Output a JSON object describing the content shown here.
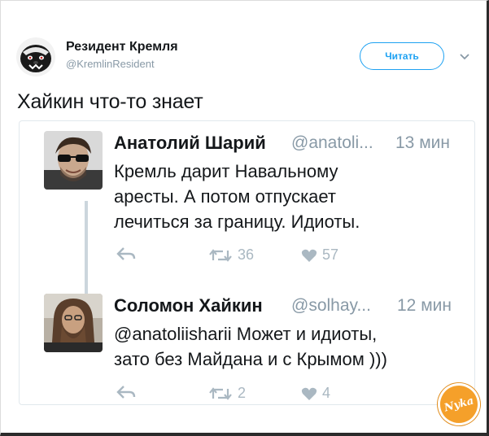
{
  "tweet": {
    "author_name": "Резидент Кремля",
    "author_handle": "@KremlinResident",
    "follow_label": "Читать",
    "text": "Хайкин что-то знает"
  },
  "quoted": [
    {
      "name": "Анатолий Шарий",
      "handle": "@anatoli...",
      "time": "13 мин",
      "lines": [
        "Кремль дарит Навальному",
        "аресты. А потом отпускает",
        "лечиться за границу. Идиоты."
      ],
      "retweets": "36",
      "likes": "57"
    },
    {
      "name": "Соломон Хайкин",
      "handle": "@solhay...",
      "time": "12 мин",
      "lines": [
        "@anatoliisharii Может и идиоты,",
        "зато без Майдана и с Крымом )))"
      ],
      "retweets": "2",
      "likes": "4"
    }
  ],
  "watermark": "Nyka",
  "colors": {
    "accent": "#1da1f2",
    "muted": "#8899a6",
    "action": "#aab8c2",
    "badge": "#f5a02a"
  },
  "icons": [
    "honey-badger-avatar",
    "chevron-down-icon",
    "reply-icon",
    "retweet-icon",
    "heart-icon"
  ]
}
